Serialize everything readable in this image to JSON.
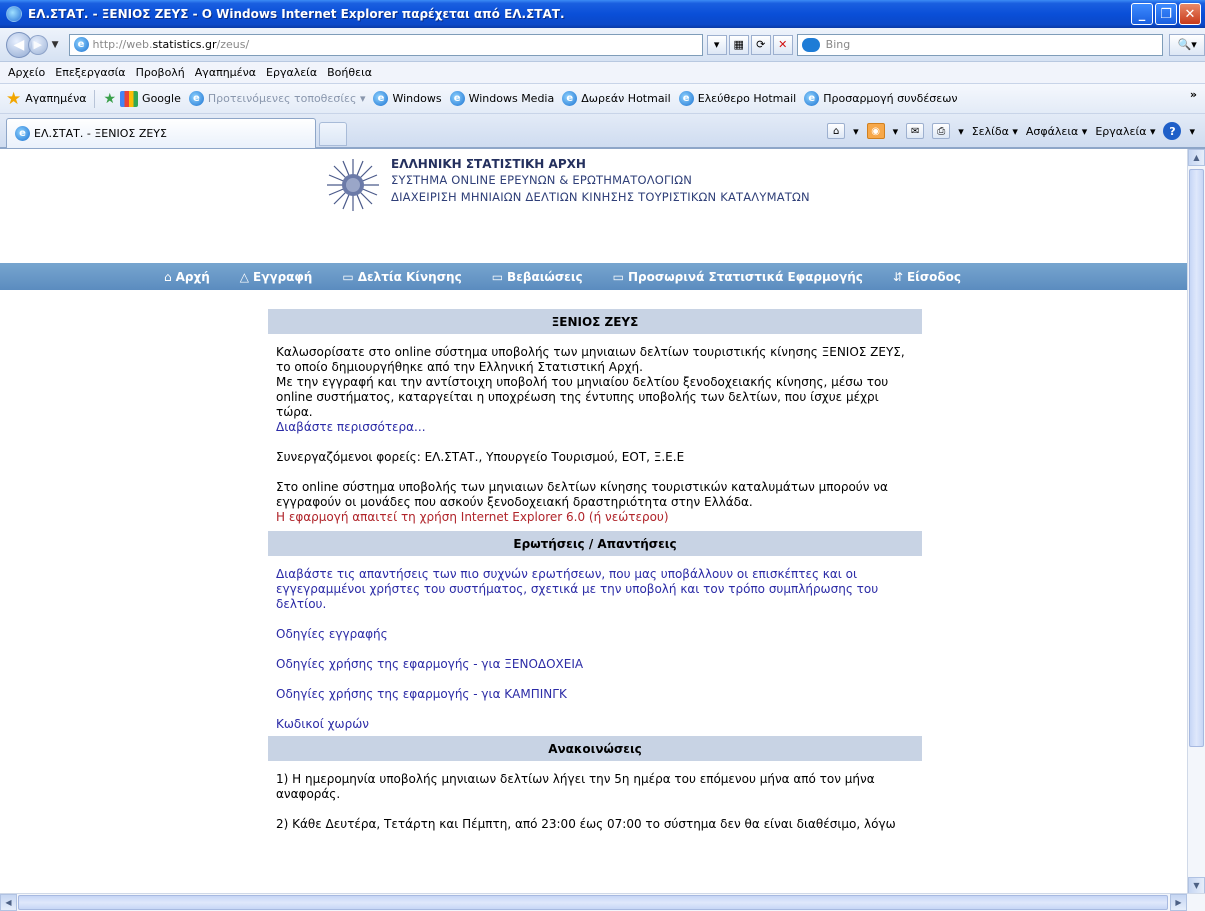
{
  "window": {
    "title": "ΕΛ.ΣΤΑΤ. - ΞΕΝΙΟΣ ΖΕΥΣ - Ο Windows Internet Explorer παρέχεται από ΕΛ.ΣΤΑΤ.",
    "minimize": "_",
    "maximize": "❐",
    "close": "✕"
  },
  "address": {
    "url_prefix": "http://web.",
    "url_domain": "statistics.gr",
    "url_path": "/zeus/",
    "search_placeholder": "Bing"
  },
  "menu": [
    "Αρχείο",
    "Επεξεργασία",
    "Προβολή",
    "Αγαπημένα",
    "Εργαλεία",
    "Βοήθεια"
  ],
  "favorites": {
    "label": "Αγαπημένα",
    "items": [
      {
        "label": "Google",
        "icon": "google-icon",
        "dim": false
      },
      {
        "label": "Προτεινόμενες τοποθεσίες ▾",
        "icon": "ie-icon",
        "dim": true
      },
      {
        "label": "Windows",
        "icon": "ie-icon",
        "dim": false
      },
      {
        "label": "Windows Media",
        "icon": "ie-icon",
        "dim": false
      },
      {
        "label": "Δωρεάν Hotmail",
        "icon": "ie-icon",
        "dim": false
      },
      {
        "label": "Ελεύθερο Hotmail",
        "icon": "ie-icon",
        "dim": false
      },
      {
        "label": "Προσαρμογή συνδέσεων",
        "icon": "ie-icon",
        "dim": false
      }
    ],
    "overflow": "»"
  },
  "tab": {
    "label": "ΕΛ.ΣΤΑΤ. - ΞΕΝΙΟΣ ΖΕΥΣ"
  },
  "commands": {
    "page": "Σελίδα ▾",
    "safety": "Ασφάλεια ▾",
    "tools": "Εργαλεία ▾",
    "help": "?"
  },
  "site": {
    "org_name": "ΕΛΛΗΝΙΚΗ ΣΤΑΤΙΣΤΙΚΗ ΑΡΧΗ",
    "sub1": "ΣΥΣΤΗΜΑ ONLINE ΕΡΕΥΝΩΝ & ΕΡΩΤΗΜΑΤΟΛΟΓΙΩΝ",
    "sub2": "ΔΙΑΧΕΙΡΙΣΗ ΜΗΝΙΑΙΩΝ ΔΕΛΤΙΩΝ ΚΙΝΗΣΗΣ ΤΟΥΡΙΣΤΙΚΩΝ ΚΑΤΑΛΥΜΑΤΩΝ"
  },
  "nav": [
    {
      "icon": "⌂",
      "label": "Αρχή"
    },
    {
      "icon": "△",
      "label": "Εγγραφή"
    },
    {
      "icon": "▭",
      "label": "Δελτία Κίνησης"
    },
    {
      "icon": "▭",
      "label": "Βεβαιώσεις"
    },
    {
      "icon": "▭",
      "label": "Προσωρινά Στατιστικά Εφαρμογής"
    },
    {
      "icon": "⇵",
      "label": "Είσοδος"
    }
  ],
  "sections": {
    "welcome": {
      "title": "ΞΕΝΙΟΣ ΖΕΥΣ",
      "p1": "Καλωσορίσατε στο online σύστημα υποβολής των μηνιαιων δελτίων τουριστικής κίνησης ΞΕΝΙΟΣ ΖΕΥΣ, το οποίο δημιουργήθηκε από την Ελληνική Στατιστική Αρχή.",
      "p2": "Με την εγγραφή και την αντίστοιχη υποβολή του μηνιαίου δελτίου ξενοδοχειακής κίνησης, μέσω του online συστήματος, καταργείται η υποχρέωση της έντυπης υποβολής των δελτίων, που ίσχυε μέχρι τώρα.",
      "read_more": "Διαβάστε περισσότερα...",
      "partners": "Συνεργαζόμενοι φορείς: ΕΛ.ΣΤΑΤ., Υπουργείο Τουρισμού, ΕΟΤ, Ξ.Ε.Ε",
      "p3": "Στο online σύστημα υποβολής των μηνιαιων δελτίων κίνησης τουριστικών καταλυμάτων μπορούν να εγγραφούν οι μονάδες που ασκούν ξενοδοχειακή δραστηριότητα στην Ελλάδα.",
      "ie_note": "Η εφαρμογή απαιτεί τη χρήση Internet Explorer 6.0 (ή νεώτερου)"
    },
    "faq": {
      "title": "Ερωτήσεις / Απαντήσεις",
      "intro": "Διαβάστε τις απαντήσεις των πιο συχνών ερωτήσεων, που μας υποβάλλουν οι επισκέπτες και οι εγγεγραμμένοι χρήστες του συστήματος, σχετικά με την υποβολή και τον τρόπο συμπλήρωσης του δελτίου.",
      "links": [
        "Οδηγίες εγγραφής",
        "Οδηγίες χρήσης της εφαρμογής - για ΞΕΝΟΔΟΧΕΙΑ",
        "Οδηγίες χρήσης της εφαρμογής - για ΚΑΜΠΙΝΓΚ",
        "Κωδικοί χωρών"
      ]
    },
    "announcements": {
      "title": "Ανακοινώσεις",
      "a1": "1) Η ημερομηνία υποβολής μηνιαιων δελτίων λήγει την 5η ημέρα του επόμενου μήνα από τον μήνα αναφοράς.",
      "a2": "2) Κάθε Δευτέρα, Τετάρτη και Πέμπτη, από 23:00 έως 07:00 το σύστημα δεν θα είναι διαθέσιμο, λόγω"
    }
  }
}
